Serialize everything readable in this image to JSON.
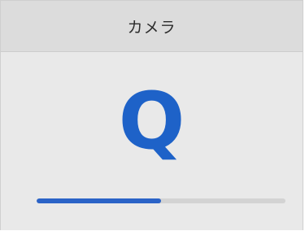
{
  "header": {
    "title": "カメラ"
  },
  "main": {
    "display_letter": "Q",
    "progress_fraction": 0.5
  },
  "colors": {
    "accent": "#1e62c8",
    "progress_fill": "#2b63c7",
    "progress_track": "#d3d3d3",
    "header_bg": "#dcdcdc",
    "body_bg": "#e9e9e9"
  }
}
